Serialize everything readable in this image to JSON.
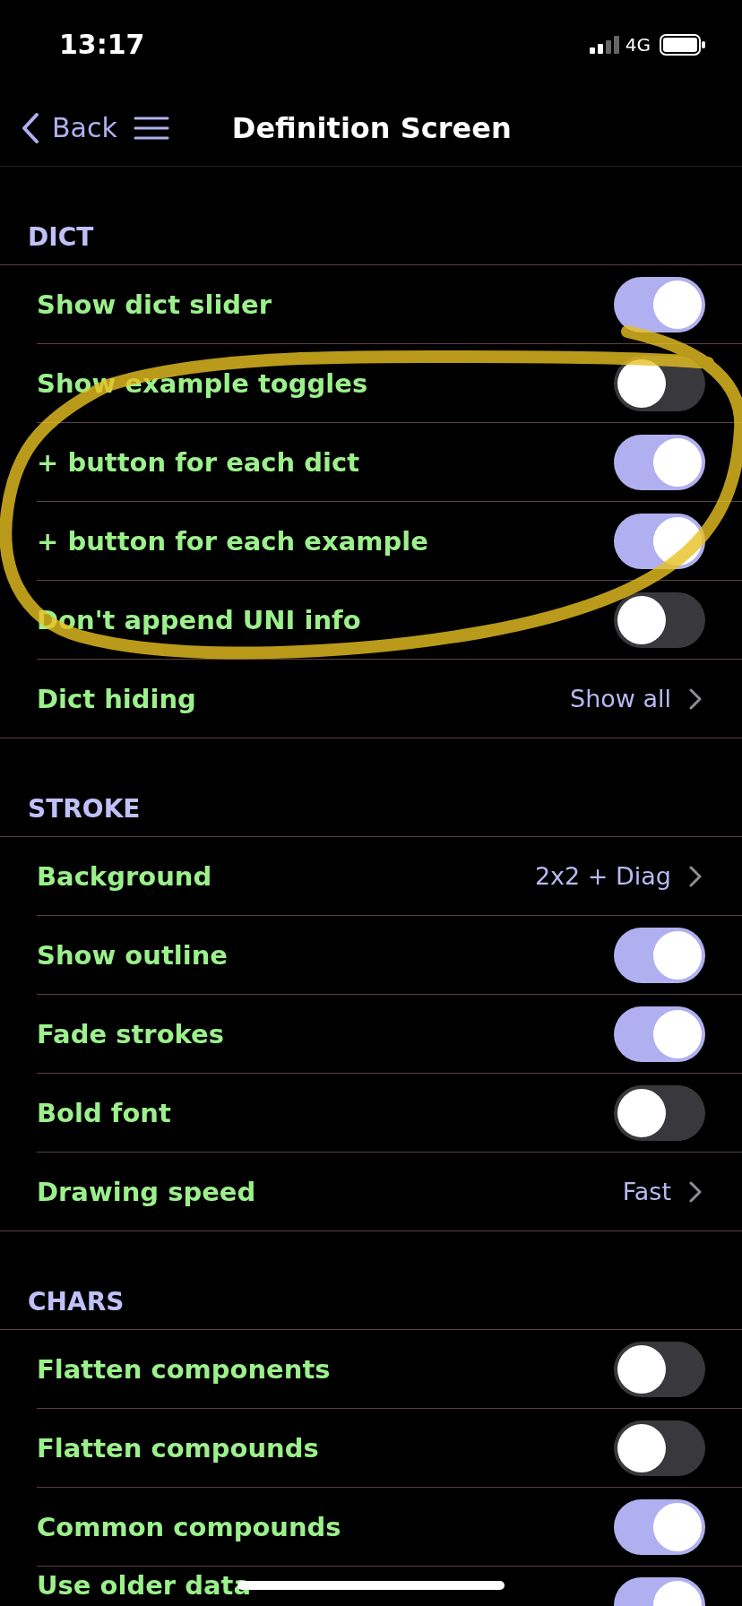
{
  "status_bar": {
    "time": "13:17",
    "network": "4G"
  },
  "nav": {
    "back_label": "Back",
    "title": "Definition Screen"
  },
  "sections": [
    {
      "title": "DICT",
      "rows": [
        {
          "kind": "toggle",
          "label": "Show dict slider",
          "on": true
        },
        {
          "kind": "toggle",
          "label": "Show example toggles",
          "on": false
        },
        {
          "kind": "toggle",
          "label": "+ button for each dict",
          "on": true
        },
        {
          "kind": "toggle",
          "label": "+ button for each example",
          "on": true
        },
        {
          "kind": "toggle",
          "label": "Don't append UNI info",
          "on": false
        },
        {
          "kind": "link",
          "label": "Dict hiding",
          "value": "Show all"
        }
      ]
    },
    {
      "title": "STROKE",
      "rows": [
        {
          "kind": "link",
          "label": "Background",
          "value": "2x2 + Diag"
        },
        {
          "kind": "toggle",
          "label": "Show outline",
          "on": true
        },
        {
          "kind": "toggle",
          "label": "Fade strokes",
          "on": true
        },
        {
          "kind": "toggle",
          "label": "Bold font",
          "on": false
        },
        {
          "kind": "link",
          "label": "Drawing speed",
          "value": "Fast"
        }
      ]
    },
    {
      "title": "CHARS",
      "rows": [
        {
          "kind": "toggle",
          "label": "Flatten components",
          "on": false
        },
        {
          "kind": "toggle",
          "label": "Flatten compounds",
          "on": false
        },
        {
          "kind": "toggle",
          "label": "Common compounds",
          "on": true
        },
        {
          "kind": "toggle",
          "label": "Use older data",
          "on": true
        }
      ]
    }
  ],
  "annotation": {
    "kind": "ellipse"
  }
}
